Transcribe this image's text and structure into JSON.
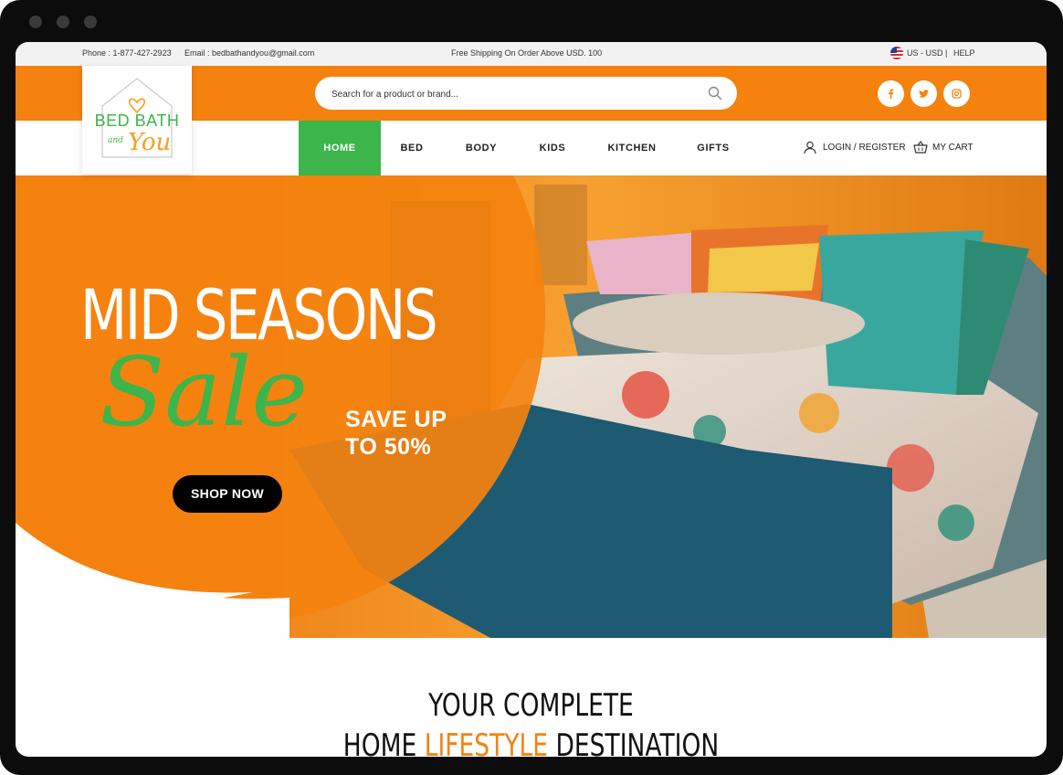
{
  "topbar": {
    "phone": "Phone : 1-877-427-2923",
    "email": "Email : bedbathandyou@gmail.com",
    "shipping": "Free Shipping On Order Above USD. 100",
    "currency": "US - USD",
    "separator": "|",
    "help": "HELP"
  },
  "logo": {
    "line1": "BED BATH",
    "line2": "and",
    "line3": "You"
  },
  "search": {
    "placeholder": "Search for a product or brand..."
  },
  "social": [
    "facebook-icon",
    "twitter-icon",
    "instagram-icon"
  ],
  "nav": {
    "items": [
      "HOME",
      "BED",
      "BODY",
      "KIDS",
      "KITCHEN",
      "GIFTS"
    ],
    "active": "HOME",
    "login": "LOGIN / REGISTER",
    "cart": "MY CART"
  },
  "hero": {
    "headline": "MID SEASONS",
    "script": "Sale",
    "save_line1": "SAVE UP",
    "save_line2": "TO 50%",
    "cta": "SHOP NOW"
  },
  "section": {
    "line1": "YOUR COMPLETE",
    "line2_a": "HOME",
    "line2_b": "LIFESTYLE",
    "line2_c": "DESTINATION"
  },
  "colors": {
    "brand_orange": "#f5820f",
    "brand_green": "#3cb54a",
    "topbar_bg": "#f2f2f2",
    "frame": "#0c0c0c"
  }
}
